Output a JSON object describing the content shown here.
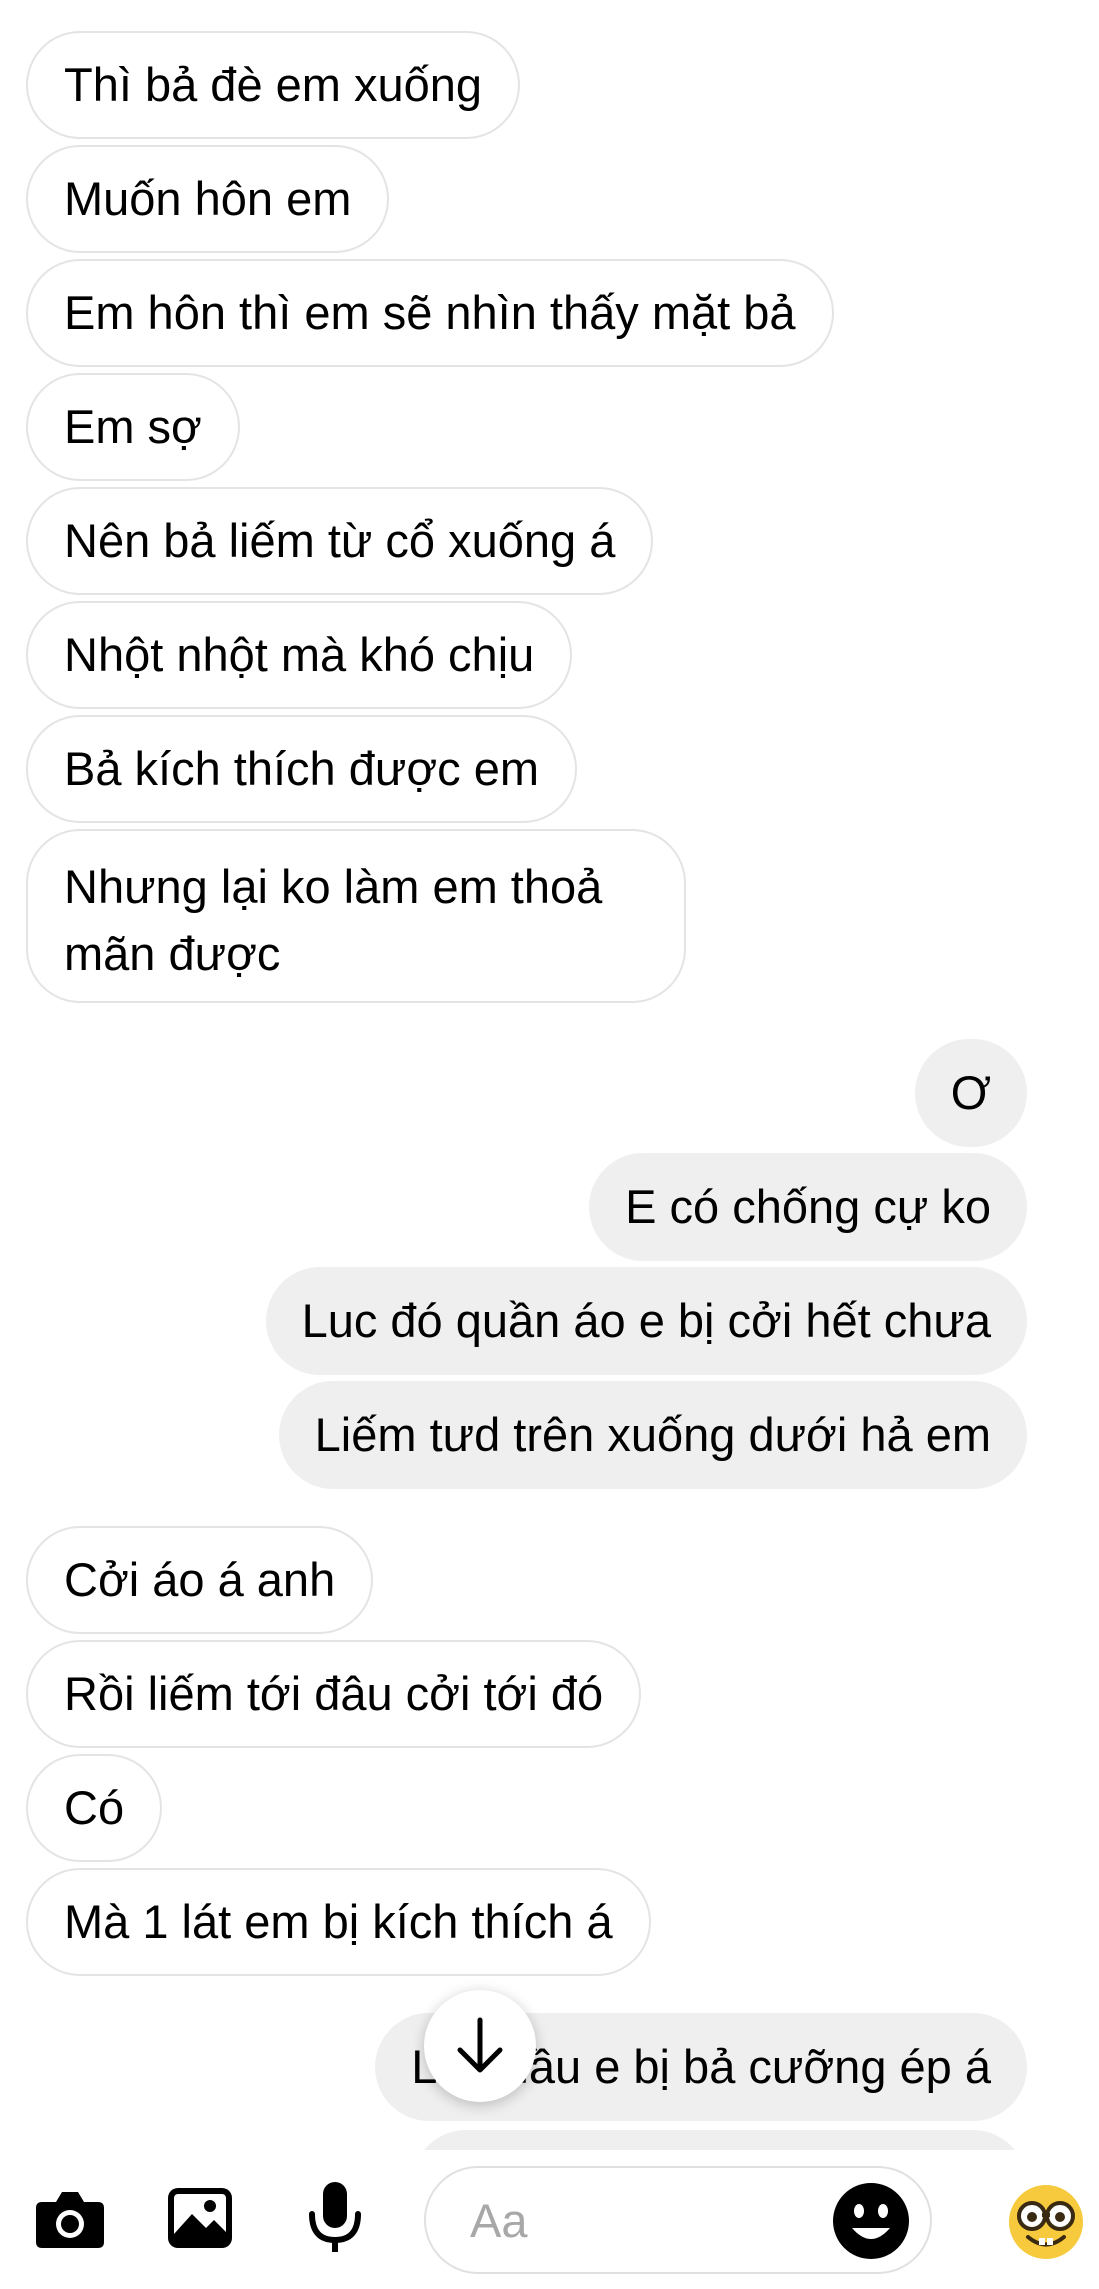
{
  "messages": [
    {
      "side": "in",
      "text": "Thì bả đè em xuống"
    },
    {
      "side": "in",
      "text": "Muốn hôn em"
    },
    {
      "side": "in",
      "text": "Em hôn thì em sẽ nhìn thấy mặt bả"
    },
    {
      "side": "in",
      "text": "Em sợ"
    },
    {
      "side": "in",
      "text": "Nên bả liếm từ cổ xuống á"
    },
    {
      "side": "in",
      "text": "Nhột nhột mà khó chịu"
    },
    {
      "side": "in",
      "text": "Bả kích thích được em"
    },
    {
      "side": "in",
      "text": "Nhưng lại ko làm em thoả mãn được"
    },
    {
      "side": "out",
      "text": "Ơ"
    },
    {
      "side": "out",
      "text": "E có chống cự ko"
    },
    {
      "side": "out",
      "text": "Luc đó quần áo e bị cởi hết chưa"
    },
    {
      "side": "out",
      "text": "Liếm tưd trên xuống dưới hả em"
    },
    {
      "side": "in",
      "text": "Cởi áo á anh"
    },
    {
      "side": "in",
      "text": "Rồi liếm tới đâu cởi tới đó"
    },
    {
      "side": "in",
      "text": "Có"
    },
    {
      "side": "in",
      "text": "Mà 1 lát em bị kích thích á"
    },
    {
      "side": "out",
      "text": "Lần đầu e bị bả cưỡng ép á"
    }
  ],
  "composer": {
    "placeholder": "Aa",
    "icons": [
      "camera-icon",
      "gallery-icon",
      "microphone-icon",
      "smiley-icon",
      "nerd-face-icon"
    ]
  },
  "scroll_button": {
    "icon": "arrow-down-icon"
  }
}
